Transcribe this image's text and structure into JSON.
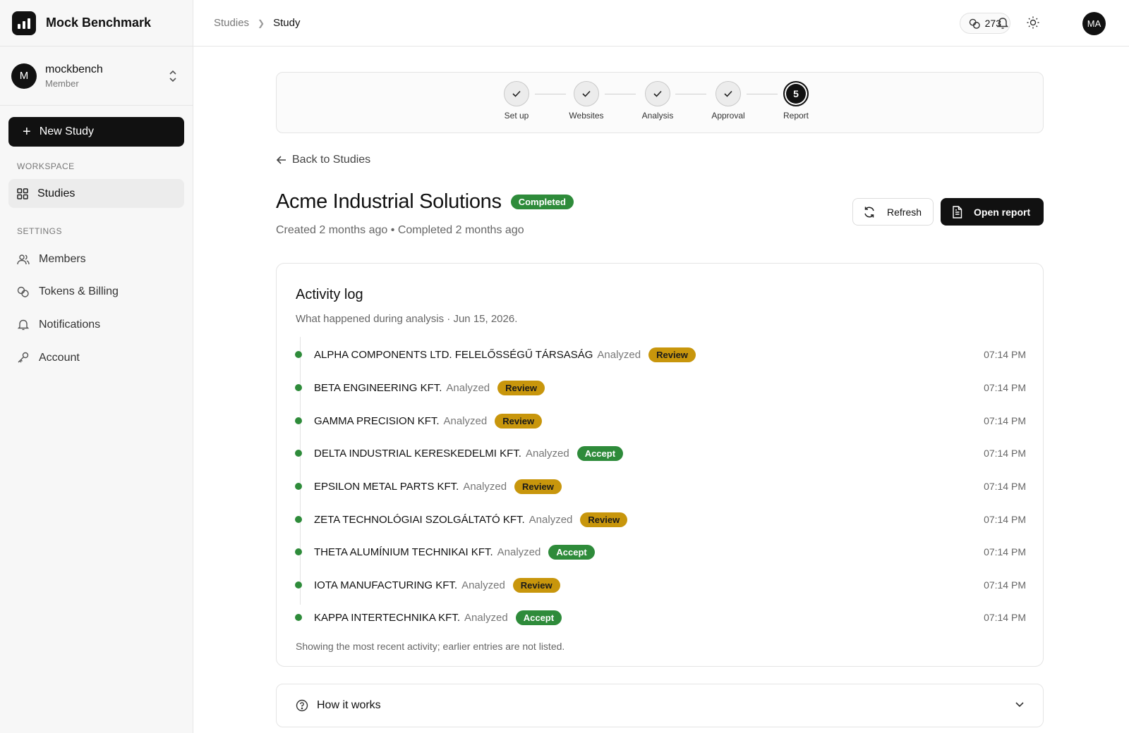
{
  "app": {
    "name": "Mock Benchmark"
  },
  "account": {
    "initial": "M",
    "name": "mockbench",
    "role": "Member"
  },
  "sidebar": {
    "new_study_label": "New Study",
    "workspace_label": "WORKSPACE",
    "settings_label": "SETTINGS",
    "items": [
      {
        "label": "Studies",
        "icon": "grid-icon"
      },
      {
        "label": "Members",
        "icon": "users-icon"
      },
      {
        "label": "Tokens & Billing",
        "icon": "coins-icon"
      },
      {
        "label": "Notifications",
        "icon": "bell-icon"
      },
      {
        "label": "Account",
        "icon": "key-icon"
      }
    ]
  },
  "header": {
    "breadcrumb": [
      "Studies",
      "Study"
    ],
    "tokens": "273",
    "user_initials": "MA"
  },
  "stepper": {
    "steps": [
      {
        "label": "Set up",
        "state": "done"
      },
      {
        "label": "Websites",
        "state": "done"
      },
      {
        "label": "Analysis",
        "state": "done"
      },
      {
        "label": "Approval",
        "state": "done"
      },
      {
        "label": "Report",
        "state": "current",
        "number": "5"
      }
    ]
  },
  "back_label": "Back to Studies",
  "study": {
    "title": "Acme Industrial Solutions",
    "status": "Completed",
    "meta": "Created 2 months ago • Completed 2 months ago",
    "refresh_label": "Refresh",
    "open_report_label": "Open report"
  },
  "activity": {
    "title": "Activity log",
    "subtitle": "What happened during analysis · Jun 15, 2026.",
    "entries": [
      {
        "name": "ALPHA COMPONENTS LTD. FELELŐSSÉGŰ TÁRSASÁG",
        "status": "Analyzed",
        "verdict": "Review",
        "time": "07:14 PM"
      },
      {
        "name": "BETA ENGINEERING KFT.",
        "status": "Analyzed",
        "verdict": "Review",
        "time": "07:14 PM"
      },
      {
        "name": "GAMMA PRECISION KFT.",
        "status": "Analyzed",
        "verdict": "Review",
        "time": "07:14 PM"
      },
      {
        "name": "DELTA INDUSTRIAL KERESKEDELMI KFT.",
        "status": "Analyzed",
        "verdict": "Accept",
        "time": "07:14 PM"
      },
      {
        "name": "EPSILON METAL PARTS KFT.",
        "status": "Analyzed",
        "verdict": "Review",
        "time": "07:14 PM"
      },
      {
        "name": "ZETA TECHNOLÓGIAI SZOLGÁLTATÓ KFT.",
        "status": "Analyzed",
        "verdict": "Review",
        "time": "07:14 PM"
      },
      {
        "name": "THETA ALUMÍNIUM TECHNIKAI KFT.",
        "status": "Analyzed",
        "verdict": "Accept",
        "time": "07:14 PM"
      },
      {
        "name": "IOTA MANUFACTURING KFT.",
        "status": "Analyzed",
        "verdict": "Review",
        "time": "07:14 PM"
      },
      {
        "name": "KAPPA INTERTECHNIKA KFT.",
        "status": "Analyzed",
        "verdict": "Accept",
        "time": "07:14 PM"
      }
    ],
    "footer": "Showing the most recent activity; earlier entries are not listed."
  },
  "how_it_works_label": "How it works",
  "colors": {
    "accept": "#2e8b3a",
    "review": "#c8960c",
    "primary": "#111111"
  }
}
